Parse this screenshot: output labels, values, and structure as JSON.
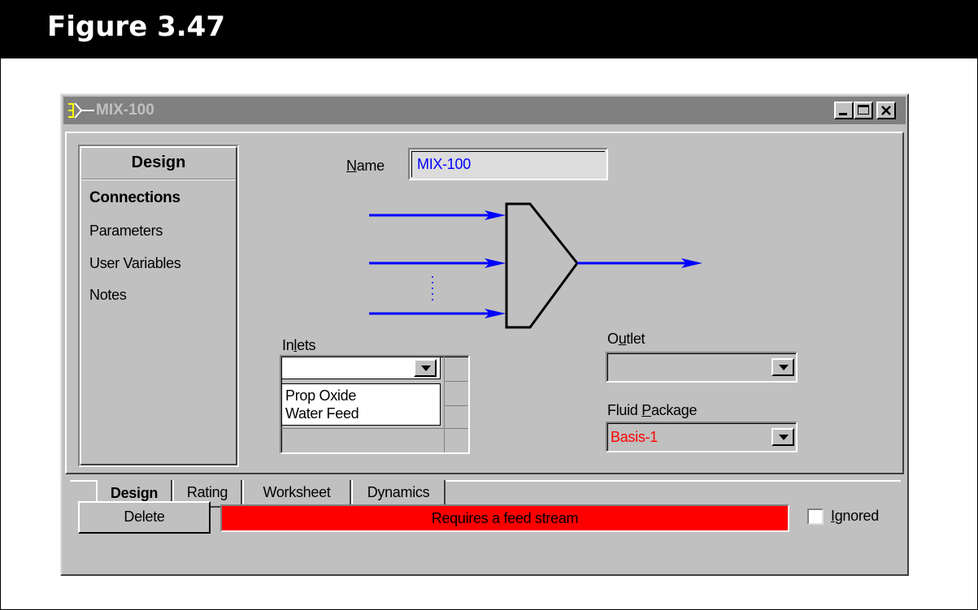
{
  "figure": {
    "title": "Figure 3.47"
  },
  "window": {
    "title": "MIX-100",
    "controls": [
      "minimize",
      "maximize",
      "close"
    ]
  },
  "nav": {
    "header": "Design",
    "items": [
      {
        "label": "Connections",
        "selected": true
      },
      {
        "label": "Parameters",
        "selected": false
      },
      {
        "label": "User Variables",
        "selected": false
      },
      {
        "label": "Notes",
        "selected": false
      }
    ]
  },
  "name_field": {
    "label": "Name",
    "accesskey": "N",
    "value": "MIX-100"
  },
  "inlets": {
    "label": "Inlets",
    "accesskey": "l",
    "selected": "",
    "list": [
      "Prop Oxide",
      "Water Feed"
    ]
  },
  "outlet": {
    "label": "Outlet",
    "accesskey": "u",
    "selected": ""
  },
  "fluid_package": {
    "label": "Fluid Package",
    "accesskey": "P",
    "selected": "Basis-1",
    "value_color": "#ff0000"
  },
  "tabs": [
    {
      "label": "Design",
      "active": true
    },
    {
      "label": "Rating",
      "active": false
    },
    {
      "label": "Worksheet",
      "active": false
    },
    {
      "label": "Dynamics",
      "active": false
    }
  ],
  "footer": {
    "delete_label": "Delete",
    "status_text": "Requires a feed stream",
    "status_color": "#ff0000",
    "ignored_label": "Ignored",
    "ignored_accesskey": "I",
    "ignored_checked": false
  },
  "diagram": {
    "stream_color": "#0000ff",
    "icon": "mixer-unit-icon"
  }
}
